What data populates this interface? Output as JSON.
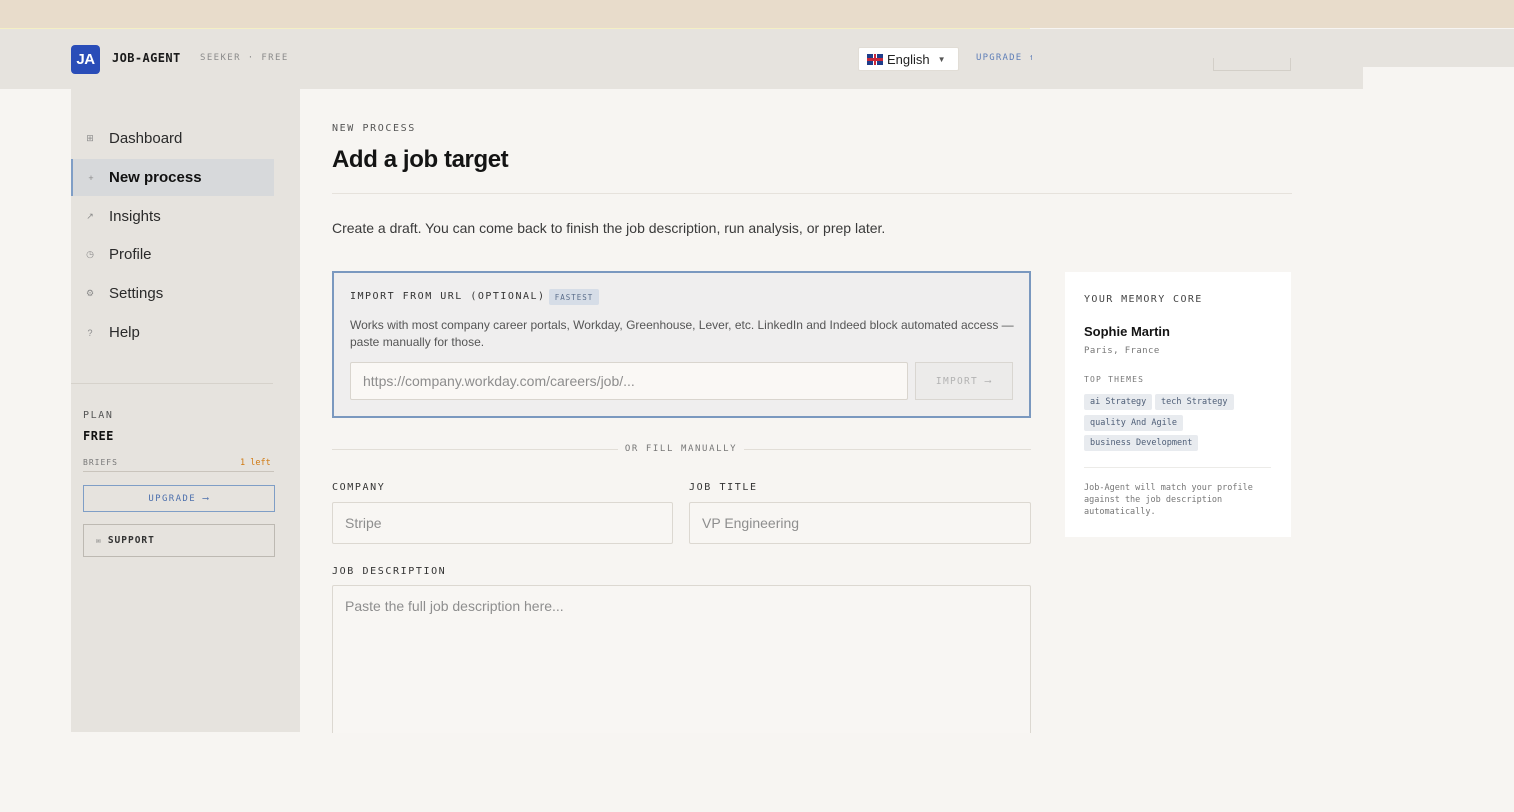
{
  "header": {
    "logo": "JA",
    "app_name": "JOB-AGENT",
    "app_sub": "SEEKER · FREE",
    "language": "English",
    "upgrade": "UPGRADE ↑"
  },
  "sidebar": {
    "items": [
      {
        "icon": "grid-icon",
        "glyph": "⊞",
        "label": "Dashboard",
        "active": false
      },
      {
        "icon": "plus-icon",
        "glyph": "+",
        "label": "New process",
        "active": true
      },
      {
        "icon": "trend-icon",
        "glyph": "↗",
        "label": "Insights",
        "active": false
      },
      {
        "icon": "user-icon",
        "glyph": "◷",
        "label": "Profile",
        "active": false
      },
      {
        "icon": "gear-icon",
        "glyph": "⚙",
        "label": "Settings",
        "active": false
      },
      {
        "icon": "help-icon",
        "glyph": "?",
        "label": "Help",
        "active": false
      }
    ],
    "plan_label": "PLAN",
    "plan_value": "FREE",
    "briefs_label": "BRIEFS",
    "briefs_left": "1 left",
    "upgrade_button": "UPGRADE ⟶",
    "support_button": "SUPPORT"
  },
  "main": {
    "eyebrow": "NEW PROCESS",
    "title": "Add a job target",
    "intro": "Create a draft. You can come back to finish the job description, run analysis, or prep later.",
    "import": {
      "heading": "IMPORT FROM URL (OPTIONAL)",
      "badge": "FASTEST",
      "description": "Works with most company career portals, Workday, Greenhouse, Lever, etc. LinkedIn and Indeed block automated access — paste manually for those.",
      "url_placeholder": "https://company.workday.com/careers/job/...",
      "button": "IMPORT ⟶"
    },
    "divider_text": "OR FILL MANUALLY",
    "company_label": "COMPANY",
    "company_placeholder": "Stripe",
    "job_title_label": "JOB TITLE",
    "job_title_placeholder": "VP Engineering",
    "description_label": "JOB DESCRIPTION",
    "description_placeholder": "Paste the full job description here..."
  },
  "memory": {
    "title": "YOUR MEMORY CORE",
    "name": "Sophie Martin",
    "location": "Paris, France",
    "themes_label": "TOP THEMES",
    "themes": [
      "ai Strategy",
      "tech Strategy",
      "quality And Agile",
      "business Development"
    ],
    "note": "Job-Agent will match your profile against the job description automatically."
  },
  "colors": {
    "accent": "#2a4db8",
    "focus_border": "#7a98bf",
    "briefs_warning": "#d07a12"
  }
}
